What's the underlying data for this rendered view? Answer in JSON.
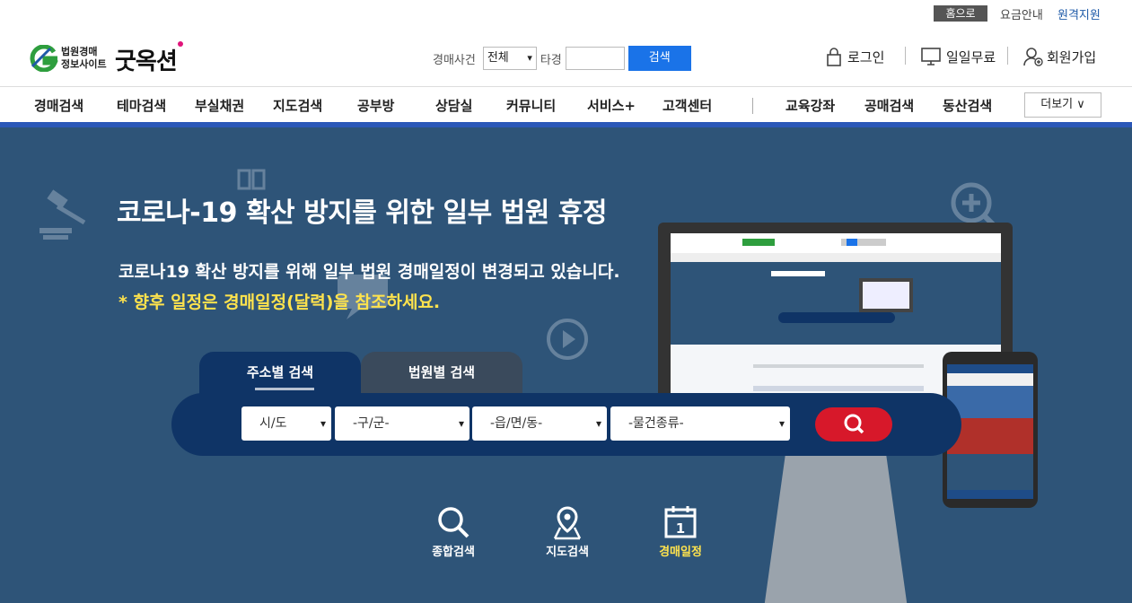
{
  "topbar": {
    "home": "홈으로",
    "fee": "요금안내",
    "remote": "원격지원"
  },
  "logo": {
    "line1": "법원경매",
    "line2": "정보사이트",
    "brand": "굿옥션"
  },
  "mini_search": {
    "label": "경매사건",
    "select_value": "전체",
    "label2": "타경",
    "input_value": "",
    "button": "검색"
  },
  "account": {
    "login": "로그인",
    "free": "일일무료",
    "join": "회원가입"
  },
  "nav": {
    "items": [
      "경매검색",
      "테마검색",
      "부실채권",
      "지도검색",
      "공부방",
      "상담실",
      "커뮤니티",
      "서비스+",
      "고객센터",
      "교육강좌",
      "공매검색",
      "동산검색"
    ],
    "more": "더보기 ∨"
  },
  "hero": {
    "title": "코로나-19 확산 방지를 위한 일부 법원 휴정",
    "desc": "코로나19 확산 방지를 위해 일부 법원 경매일정이 변경되고 있습니다.",
    "note": "* 향후 일정은 경매일정(달력)을 참조하세요."
  },
  "tabs": {
    "address": "주소별 검색",
    "court": "법원별 검색"
  },
  "filters": {
    "sido": "시/도",
    "gugun": "-구/군-",
    "dong": "-읍/면/동-",
    "type": "-물건종류-"
  },
  "quick": {
    "total": "종합검색",
    "map": "지도검색",
    "schedule": "경매일정"
  },
  "colors": {
    "hero_bg": "#2e5478",
    "accent": "#2b58b8",
    "search_btn": "#d7182a",
    "highlight": "#ffe34d"
  }
}
